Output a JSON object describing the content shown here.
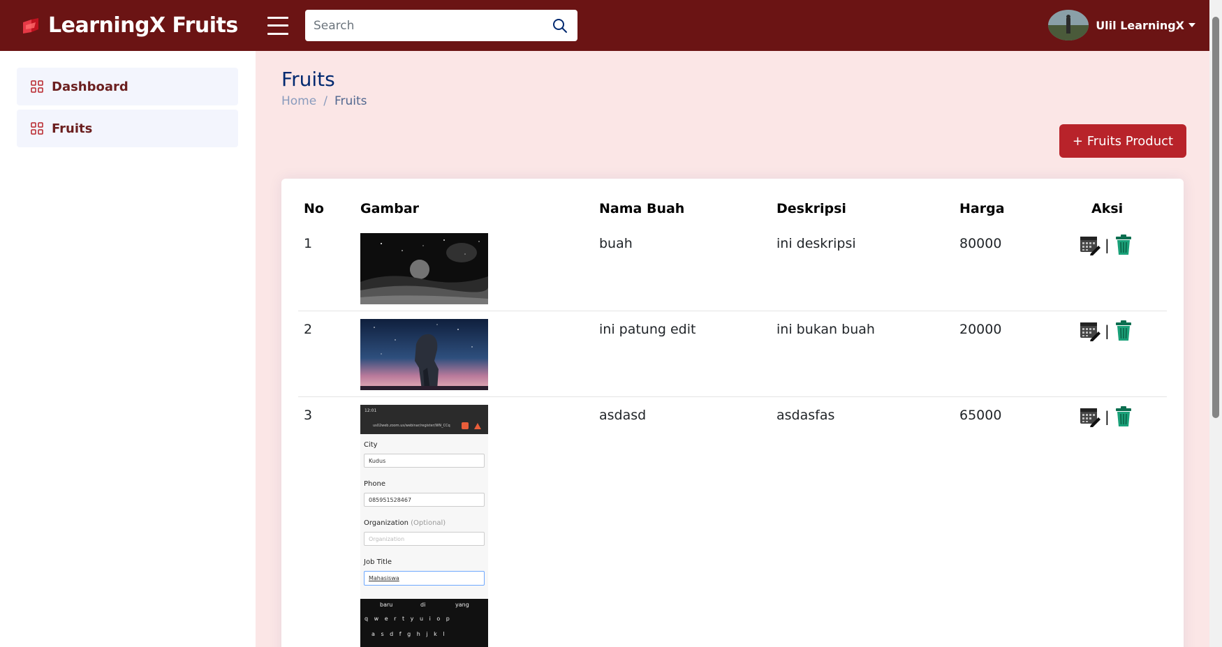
{
  "header": {
    "brand": "LearningX Fruits",
    "search_placeholder": "Search",
    "user_name": "Ulil LearningX",
    "colors": {
      "bar": "#6b1414",
      "accent": "#b8232a"
    }
  },
  "sidebar": {
    "items": [
      {
        "label": "Dashboard",
        "icon": "grid-icon"
      },
      {
        "label": "Fruits",
        "icon": "grid-icon"
      }
    ]
  },
  "page": {
    "title": "Fruits",
    "breadcrumb": {
      "home": "Home",
      "separator": "/",
      "current": "Fruits"
    },
    "add_button": "+ Fruits Product"
  },
  "table": {
    "headers": [
      "No",
      "Gambar",
      "Nama Buah",
      "Deskripsi",
      "Harga",
      "Aksi"
    ],
    "rows": [
      {
        "no": "1",
        "name": "buah",
        "desc": "ini deskripsi",
        "price": "80000",
        "image": "moon-space-image"
      },
      {
        "no": "2",
        "name": "ini patung edit",
        "desc": "ini bukan buah",
        "price": "20000",
        "image": "moai-statue-image"
      },
      {
        "no": "3",
        "name": "asdasd",
        "desc": "asdasfas",
        "price": "65000",
        "image": "phone-form-screenshot"
      }
    ],
    "action_separator": "|"
  },
  "thumb3": {
    "status_time": "12:01",
    "url": "us02web.zoom.us/webinar/register/WN_CCq",
    "city_label": "City",
    "city_value": "Kudus",
    "phone_label": "Phone",
    "phone_value": "085951528467",
    "org_label": "Organization",
    "org_optional": "(Optional)",
    "org_placeholder": "Organization",
    "job_label": "Job Title",
    "job_value": "Mahasiswa",
    "suggest_1": "baru",
    "suggest_2": "di",
    "suggest_3": "yang",
    "keys_row1": "q w e r t y u i o p",
    "keys_row2": "a s d f g h j k l"
  }
}
